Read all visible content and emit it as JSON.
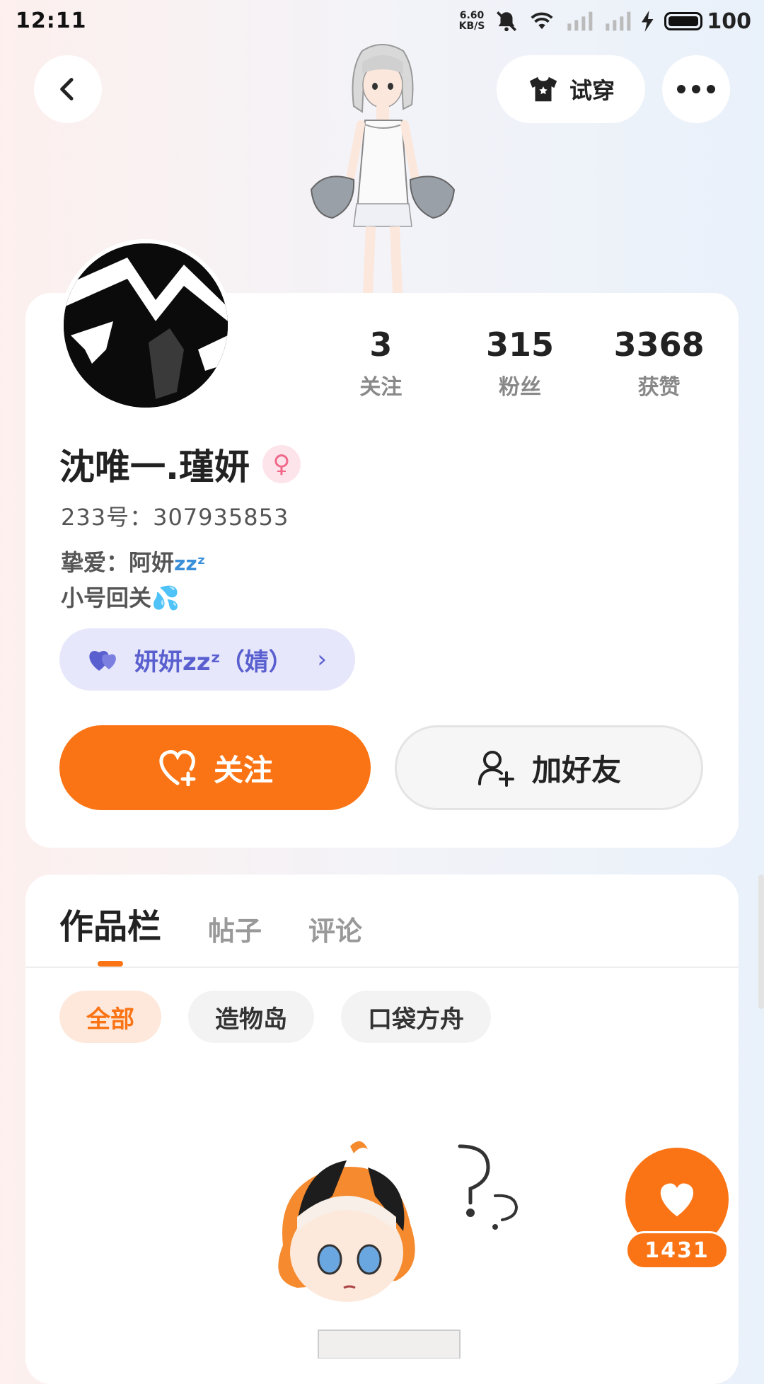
{
  "status_bar": {
    "time": "12:11",
    "net_speed_value": "6.60",
    "net_speed_unit": "KB/S",
    "battery": "100"
  },
  "header": {
    "try_on_label": "试穿"
  },
  "profile": {
    "stats": [
      {
        "value": "3",
        "label": "关注"
      },
      {
        "value": "315",
        "label": "粉丝"
      },
      {
        "value": "3368",
        "label": "获赞"
      }
    ],
    "username": "沈唯一.瑾妍",
    "gender_symbol": "♀",
    "uid_text": "233号：307935853",
    "bio_line1": "挚爱：阿妍",
    "bio_line1_extra": "zzᶻ",
    "bio_line2": "小号回关💦",
    "cp_label": "妍妍zzᶻ（婧）",
    "follow_label": "关注",
    "add_friend_label": "加好友"
  },
  "tabs": [
    {
      "label": "作品栏",
      "active": true
    },
    {
      "label": "帖子",
      "active": false
    },
    {
      "label": "评论",
      "active": false
    }
  ],
  "filters": [
    {
      "label": "全部",
      "active": true
    },
    {
      "label": "造物岛",
      "active": false
    },
    {
      "label": "口袋方舟",
      "active": false
    }
  ],
  "like_count": "1431",
  "colors": {
    "accent": "#fa7415",
    "cp_pill_bg": "#e6e7fb",
    "cp_text": "#5a5fd0",
    "gender_pink": "#f0698a"
  }
}
